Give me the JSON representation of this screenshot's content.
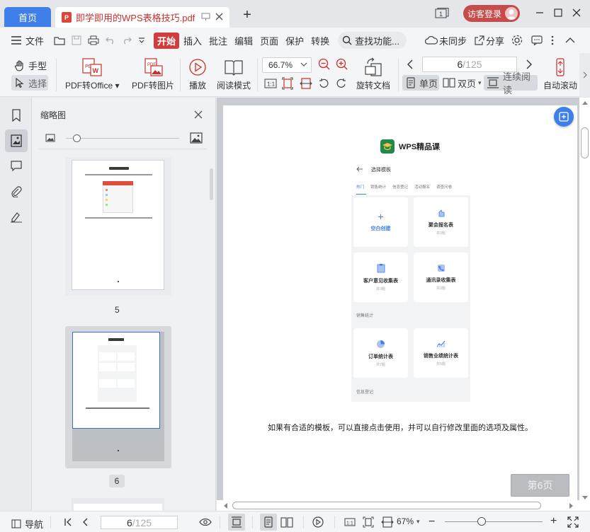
{
  "tabs": {
    "home": "首页",
    "document": "即学即用的WPS表格技巧.pdf",
    "new_tab": "+"
  },
  "user": {
    "login": "访客登录"
  },
  "menu": {
    "file": "文件",
    "items": [
      "开始",
      "插入",
      "批注",
      "编辑",
      "页面",
      "保护",
      "转换"
    ],
    "search": "查找功能...",
    "sync": "未同步",
    "share": "分享"
  },
  "ribbon": {
    "hand": "手型",
    "select": "选择",
    "pdf_to_office": "PDF转Office",
    "pdf_to_image": "PDF转图片",
    "play": "播放",
    "read_mode": "阅读模式",
    "zoom": "66.7%",
    "rotate_doc": "旋转文档",
    "page_current": "6",
    "page_total": "/125",
    "single": "单页",
    "double": "双页",
    "continuous": "连续阅读",
    "auto_scroll": "自动滚动"
  },
  "thumbnails": {
    "title": "缩略图",
    "zoom_fraction": 0.1,
    "pages": [
      {
        "number": "5",
        "caption": "在如下界面中，选择所需模板，或者选择新建空白表单完成创建"
      },
      {
        "number": "6",
        "caption": "如果有合适的模板，可以直接点击使用，并可以自行修改里面的选项及属性。"
      }
    ]
  },
  "page": {
    "brand": "WPS精品课",
    "screen_title": "选择模板",
    "tabs": [
      "热门",
      "销售统计",
      "信息登记",
      "活动报名",
      "调查问卷"
    ],
    "cards": [
      {
        "name": "空白创建",
        "sub": ""
      },
      {
        "name": "聚会报名表",
        "sub": "共3题"
      },
      {
        "name": "客户意见收集表",
        "sub": "共3题"
      },
      {
        "name": "通讯录收集表",
        "sub": "共3题"
      }
    ],
    "section_sales": "销售统计",
    "cards_sales": [
      {
        "name": "订单统计表",
        "sub": "共7题"
      },
      {
        "name": "销售业绩统计表",
        "sub": "共5题"
      }
    ],
    "section_info": "信息登记",
    "caption": "如果有合适的模板，可以直接点击使用，并可以自行修改里面的选项及属性。",
    "page_badge": "第6页"
  },
  "status": {
    "nav": "导航",
    "page_current": "6",
    "page_total": "/125",
    "zoom": "67%",
    "zoom_fraction": 0.38
  },
  "colors": {
    "accent_blue": "#3f7fe8",
    "accent_red": "#d23c3c",
    "wps_green": "#1f8a4c"
  }
}
